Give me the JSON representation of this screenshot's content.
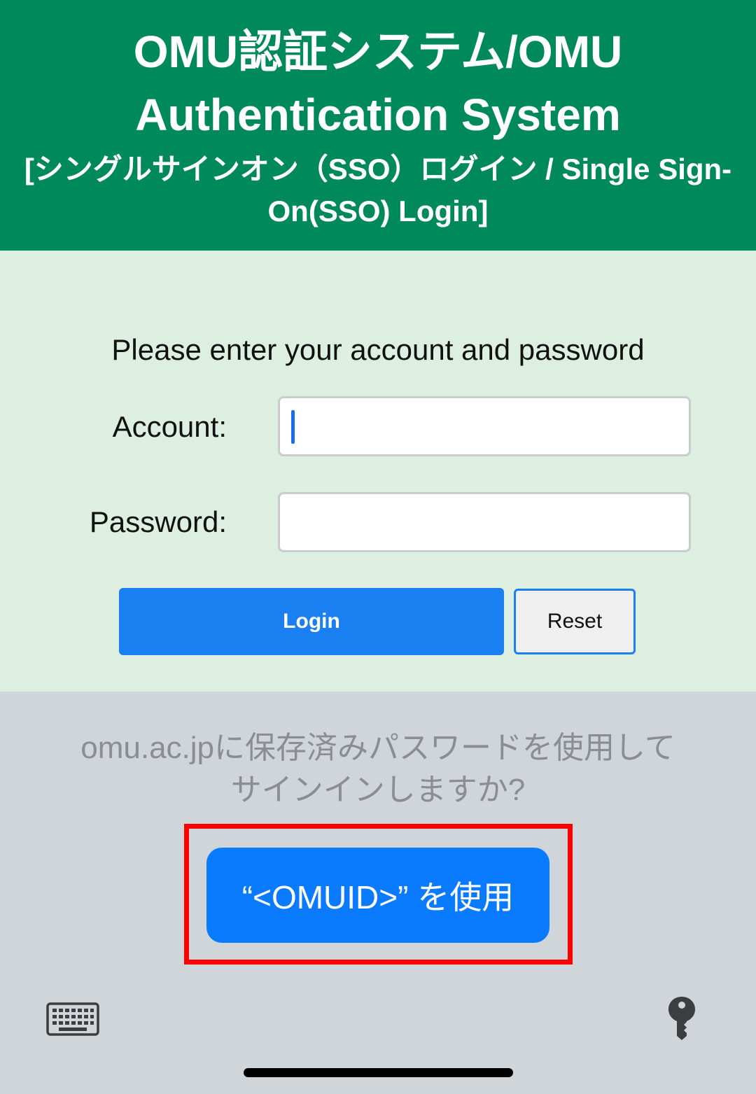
{
  "header": {
    "title_line1": "OMU認証システム/OMU",
    "title_line2": "Authentication System",
    "subtitle_line1": "[シングルサインオン（SSO）ログイン / Single Sign-",
    "subtitle_line2": "On(SSO) Login]",
    "background_color": "#00895a"
  },
  "form": {
    "prompt": "Please enter your account and password",
    "account_label": "Account:",
    "account_value": "",
    "password_label": "Password:",
    "password_value": "",
    "login_label": "Login",
    "reset_label": "Reset"
  },
  "password_suggestion": {
    "message_line1": "omu.ac.jpに保存済みパスワードを使用して",
    "message_line2": "サインインしますか?",
    "use_button_label": "“<OMUID>” を使用",
    "highlight_color": "#ff0000"
  },
  "keyboard_bar": {
    "left_icon": "keyboard-icon",
    "right_icon": "key-icon"
  }
}
